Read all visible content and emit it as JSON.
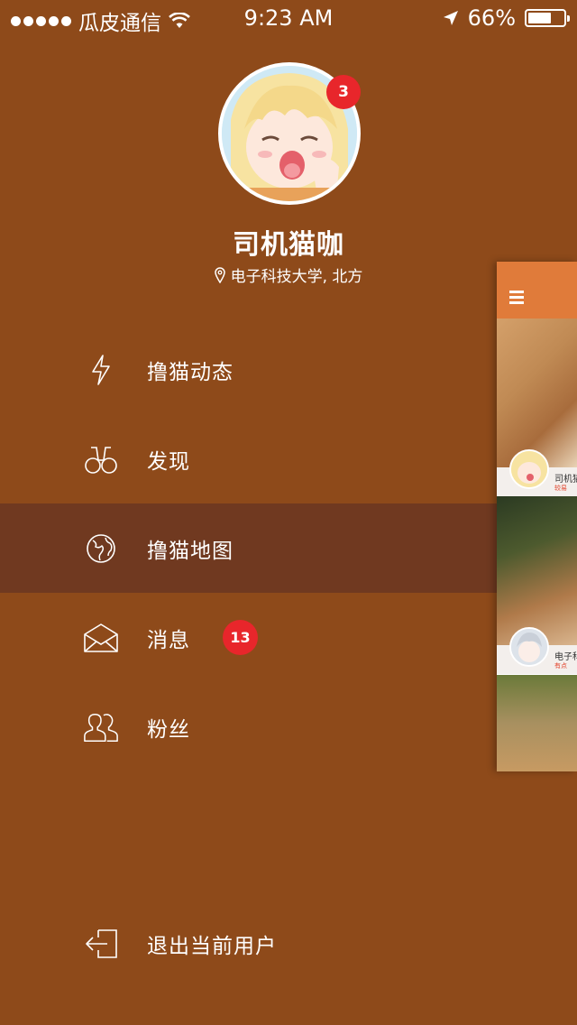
{
  "status_bar": {
    "carrier": "瓜皮通信",
    "time": "9:23 AM",
    "battery": "66%",
    "battery_level": 0.66
  },
  "profile": {
    "name": "司机猫咖",
    "location": "电子科技大学, 北方",
    "notification_count": "3"
  },
  "menu": {
    "items": [
      {
        "label": "撸猫动态",
        "icon": "lightning-icon"
      },
      {
        "label": "发现",
        "icon": "binoculars-icon"
      },
      {
        "label": "撸猫地图",
        "icon": "globe-icon",
        "active": true
      },
      {
        "label": "消息",
        "icon": "envelope-icon",
        "badge": "13"
      },
      {
        "label": "粉丝",
        "icon": "users-icon"
      }
    ],
    "logout": {
      "label": "退出当前用户",
      "icon": "logout-icon"
    }
  },
  "main_peek": {
    "cards": [
      {
        "author": "司机猫",
        "sub": "较易"
      },
      {
        "author": "电子科",
        "sub": "有点"
      }
    ]
  },
  "colors": {
    "drawer_bg": "#8e4a1a",
    "active_bg": "#703920",
    "badge": "#e8262b",
    "accent": "#e07b3a"
  }
}
